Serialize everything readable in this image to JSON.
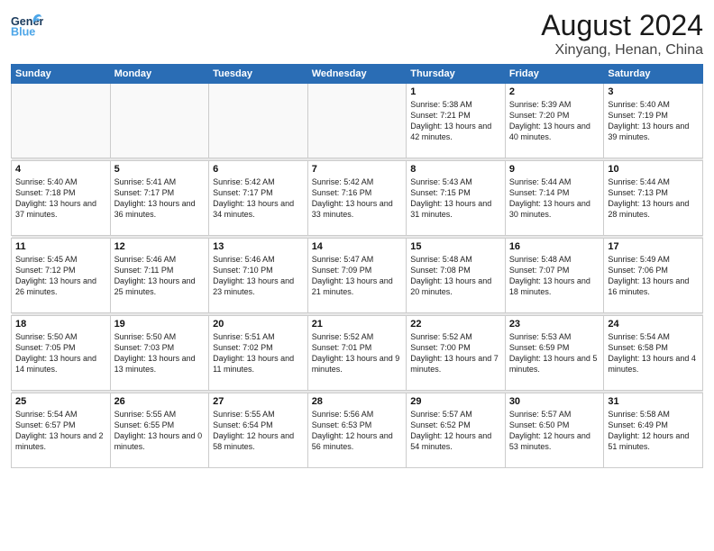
{
  "header": {
    "logo_general": "General",
    "logo_blue": "Blue",
    "month_year": "August 2024",
    "location": "Xinyang, Henan, China"
  },
  "days_of_week": [
    "Sunday",
    "Monday",
    "Tuesday",
    "Wednesday",
    "Thursday",
    "Friday",
    "Saturday"
  ],
  "weeks": [
    [
      {
        "day": "",
        "info": ""
      },
      {
        "day": "",
        "info": ""
      },
      {
        "day": "",
        "info": ""
      },
      {
        "day": "",
        "info": ""
      },
      {
        "day": "1",
        "info": "Sunrise: 5:38 AM\nSunset: 7:21 PM\nDaylight: 13 hours\nand 42 minutes."
      },
      {
        "day": "2",
        "info": "Sunrise: 5:39 AM\nSunset: 7:20 PM\nDaylight: 13 hours\nand 40 minutes."
      },
      {
        "day": "3",
        "info": "Sunrise: 5:40 AM\nSunset: 7:19 PM\nDaylight: 13 hours\nand 39 minutes."
      }
    ],
    [
      {
        "day": "4",
        "info": "Sunrise: 5:40 AM\nSunset: 7:18 PM\nDaylight: 13 hours\nand 37 minutes."
      },
      {
        "day": "5",
        "info": "Sunrise: 5:41 AM\nSunset: 7:17 PM\nDaylight: 13 hours\nand 36 minutes."
      },
      {
        "day": "6",
        "info": "Sunrise: 5:42 AM\nSunset: 7:17 PM\nDaylight: 13 hours\nand 34 minutes."
      },
      {
        "day": "7",
        "info": "Sunrise: 5:42 AM\nSunset: 7:16 PM\nDaylight: 13 hours\nand 33 minutes."
      },
      {
        "day": "8",
        "info": "Sunrise: 5:43 AM\nSunset: 7:15 PM\nDaylight: 13 hours\nand 31 minutes."
      },
      {
        "day": "9",
        "info": "Sunrise: 5:44 AM\nSunset: 7:14 PM\nDaylight: 13 hours\nand 30 minutes."
      },
      {
        "day": "10",
        "info": "Sunrise: 5:44 AM\nSunset: 7:13 PM\nDaylight: 13 hours\nand 28 minutes."
      }
    ],
    [
      {
        "day": "11",
        "info": "Sunrise: 5:45 AM\nSunset: 7:12 PM\nDaylight: 13 hours\nand 26 minutes."
      },
      {
        "day": "12",
        "info": "Sunrise: 5:46 AM\nSunset: 7:11 PM\nDaylight: 13 hours\nand 25 minutes."
      },
      {
        "day": "13",
        "info": "Sunrise: 5:46 AM\nSunset: 7:10 PM\nDaylight: 13 hours\nand 23 minutes."
      },
      {
        "day": "14",
        "info": "Sunrise: 5:47 AM\nSunset: 7:09 PM\nDaylight: 13 hours\nand 21 minutes."
      },
      {
        "day": "15",
        "info": "Sunrise: 5:48 AM\nSunset: 7:08 PM\nDaylight: 13 hours\nand 20 minutes."
      },
      {
        "day": "16",
        "info": "Sunrise: 5:48 AM\nSunset: 7:07 PM\nDaylight: 13 hours\nand 18 minutes."
      },
      {
        "day": "17",
        "info": "Sunrise: 5:49 AM\nSunset: 7:06 PM\nDaylight: 13 hours\nand 16 minutes."
      }
    ],
    [
      {
        "day": "18",
        "info": "Sunrise: 5:50 AM\nSunset: 7:05 PM\nDaylight: 13 hours\nand 14 minutes."
      },
      {
        "day": "19",
        "info": "Sunrise: 5:50 AM\nSunset: 7:03 PM\nDaylight: 13 hours\nand 13 minutes."
      },
      {
        "day": "20",
        "info": "Sunrise: 5:51 AM\nSunset: 7:02 PM\nDaylight: 13 hours\nand 11 minutes."
      },
      {
        "day": "21",
        "info": "Sunrise: 5:52 AM\nSunset: 7:01 PM\nDaylight: 13 hours\nand 9 minutes."
      },
      {
        "day": "22",
        "info": "Sunrise: 5:52 AM\nSunset: 7:00 PM\nDaylight: 13 hours\nand 7 minutes."
      },
      {
        "day": "23",
        "info": "Sunrise: 5:53 AM\nSunset: 6:59 PM\nDaylight: 13 hours\nand 5 minutes."
      },
      {
        "day": "24",
        "info": "Sunrise: 5:54 AM\nSunset: 6:58 PM\nDaylight: 13 hours\nand 4 minutes."
      }
    ],
    [
      {
        "day": "25",
        "info": "Sunrise: 5:54 AM\nSunset: 6:57 PM\nDaylight: 13 hours\nand 2 minutes."
      },
      {
        "day": "26",
        "info": "Sunrise: 5:55 AM\nSunset: 6:55 PM\nDaylight: 13 hours\nand 0 minutes."
      },
      {
        "day": "27",
        "info": "Sunrise: 5:55 AM\nSunset: 6:54 PM\nDaylight: 12 hours\nand 58 minutes."
      },
      {
        "day": "28",
        "info": "Sunrise: 5:56 AM\nSunset: 6:53 PM\nDaylight: 12 hours\nand 56 minutes."
      },
      {
        "day": "29",
        "info": "Sunrise: 5:57 AM\nSunset: 6:52 PM\nDaylight: 12 hours\nand 54 minutes."
      },
      {
        "day": "30",
        "info": "Sunrise: 5:57 AM\nSunset: 6:50 PM\nDaylight: 12 hours\nand 53 minutes."
      },
      {
        "day": "31",
        "info": "Sunrise: 5:58 AM\nSunset: 6:49 PM\nDaylight: 12 hours\nand 51 minutes."
      }
    ]
  ]
}
